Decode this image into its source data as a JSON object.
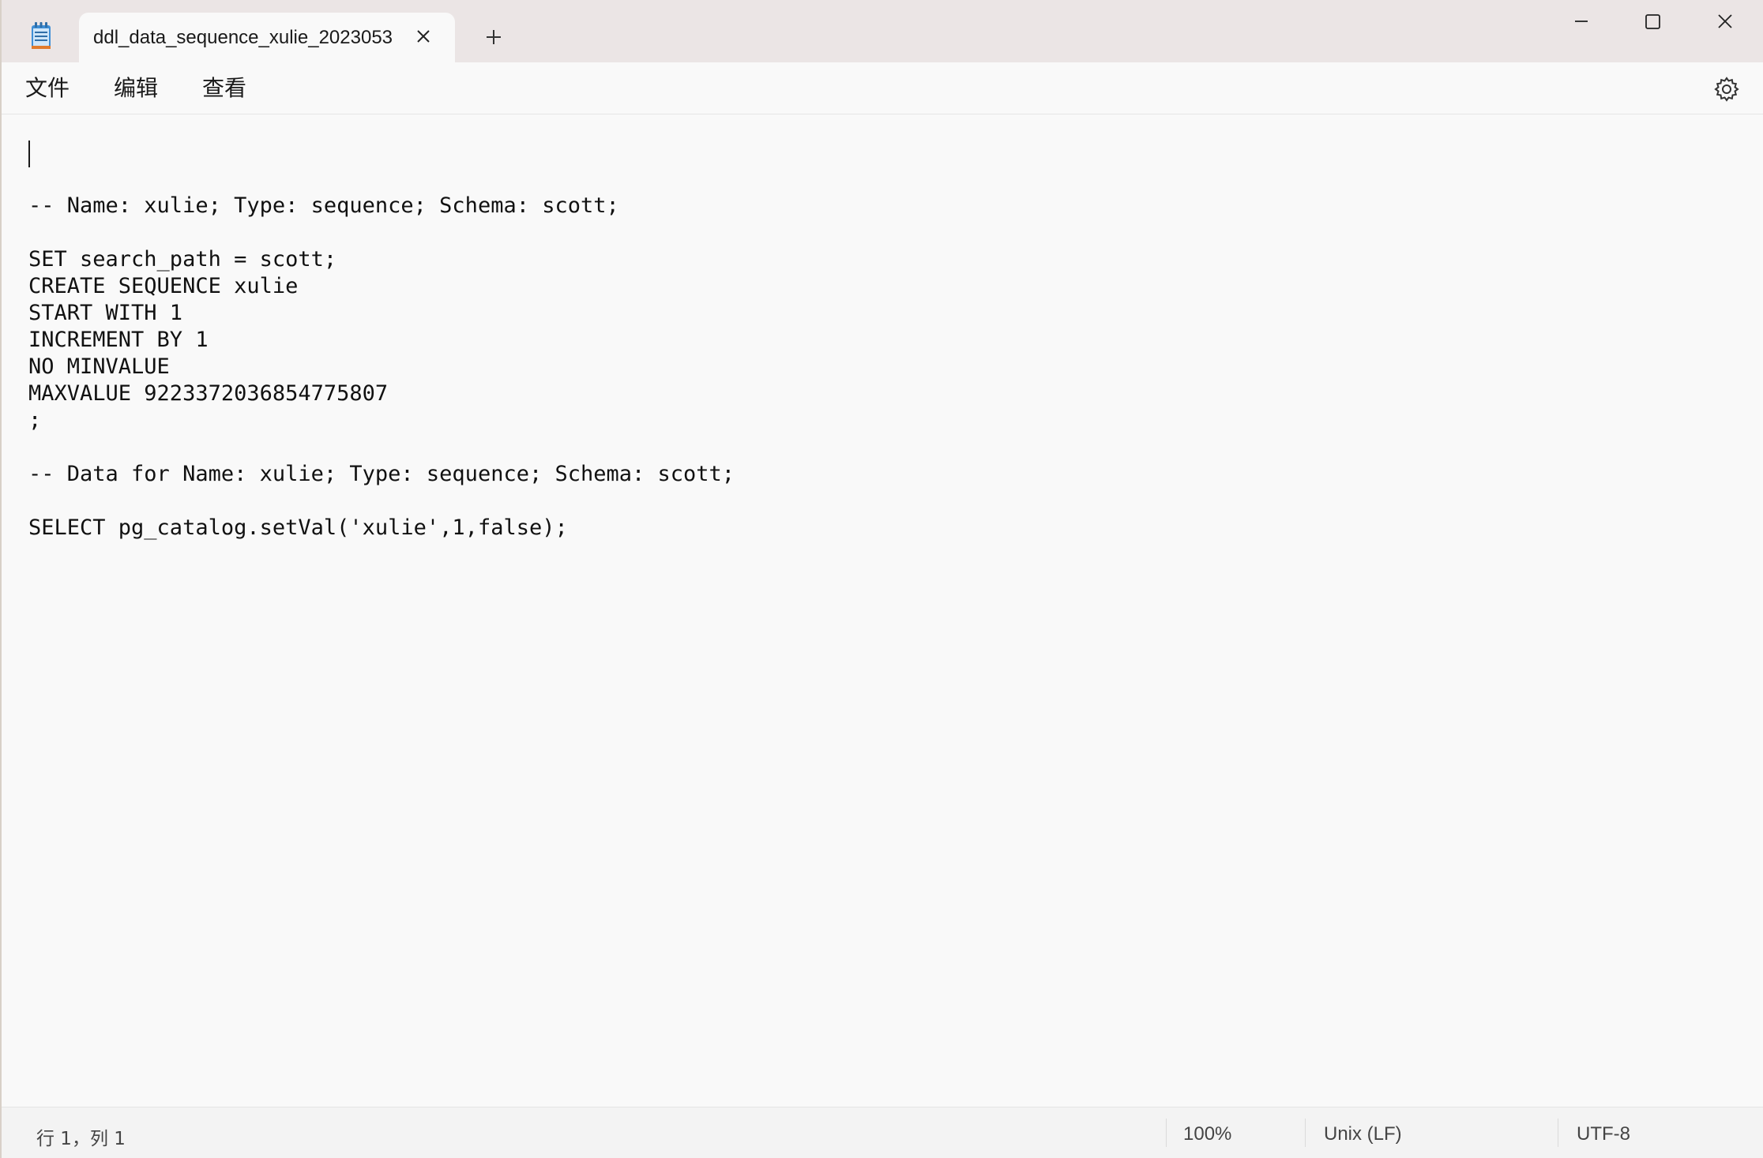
{
  "app": {
    "icon": "notepad-icon"
  },
  "tab": {
    "title": "ddl_data_sequence_xulie_2023053",
    "close_icon": "close-icon"
  },
  "new_tab_icon": "plus-icon",
  "window_controls": {
    "minimize_icon": "minimize-icon",
    "maximize_icon": "maximize-icon",
    "close_icon": "close-icon"
  },
  "menu": {
    "file": "文件",
    "edit": "编辑",
    "view": "查看",
    "settings_icon": "gear-icon"
  },
  "editor": {
    "lines": [
      "",
      "",
      "-- Name: xulie; Type: sequence; Schema: scott;",
      "",
      "SET search_path = scott;",
      "CREATE SEQUENCE xulie",
      "START WITH 1",
      "INCREMENT BY 1",
      "NO MINVALUE",
      "MAXVALUE 9223372036854775807",
      ";",
      "",
      "-- Data for Name: xulie; Type: sequence; Schema: scott;",
      "",
      "SELECT pg_catalog.setVal('xulie',1,false);"
    ]
  },
  "status": {
    "position": "行 1，列 1",
    "zoom": "100%",
    "line_ending": "Unix (LF)",
    "encoding": "UTF-8"
  }
}
